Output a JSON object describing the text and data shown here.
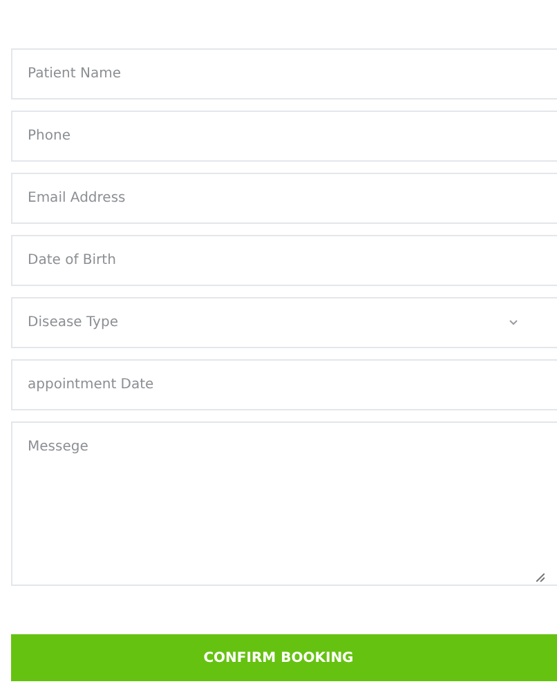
{
  "form": {
    "fields": [
      {
        "kind": "text",
        "placeholder": "Patient Name"
      },
      {
        "kind": "text",
        "placeholder": "Phone"
      },
      {
        "kind": "text",
        "placeholder": "Email Address"
      },
      {
        "kind": "text",
        "placeholder": "Date of Birth"
      },
      {
        "kind": "select",
        "placeholder": "Disease Type"
      },
      {
        "kind": "text",
        "placeholder": "appointment Date"
      },
      {
        "kind": "textarea",
        "placeholder": "Messege"
      }
    ],
    "submit": "CONFIRM BOOKING"
  }
}
